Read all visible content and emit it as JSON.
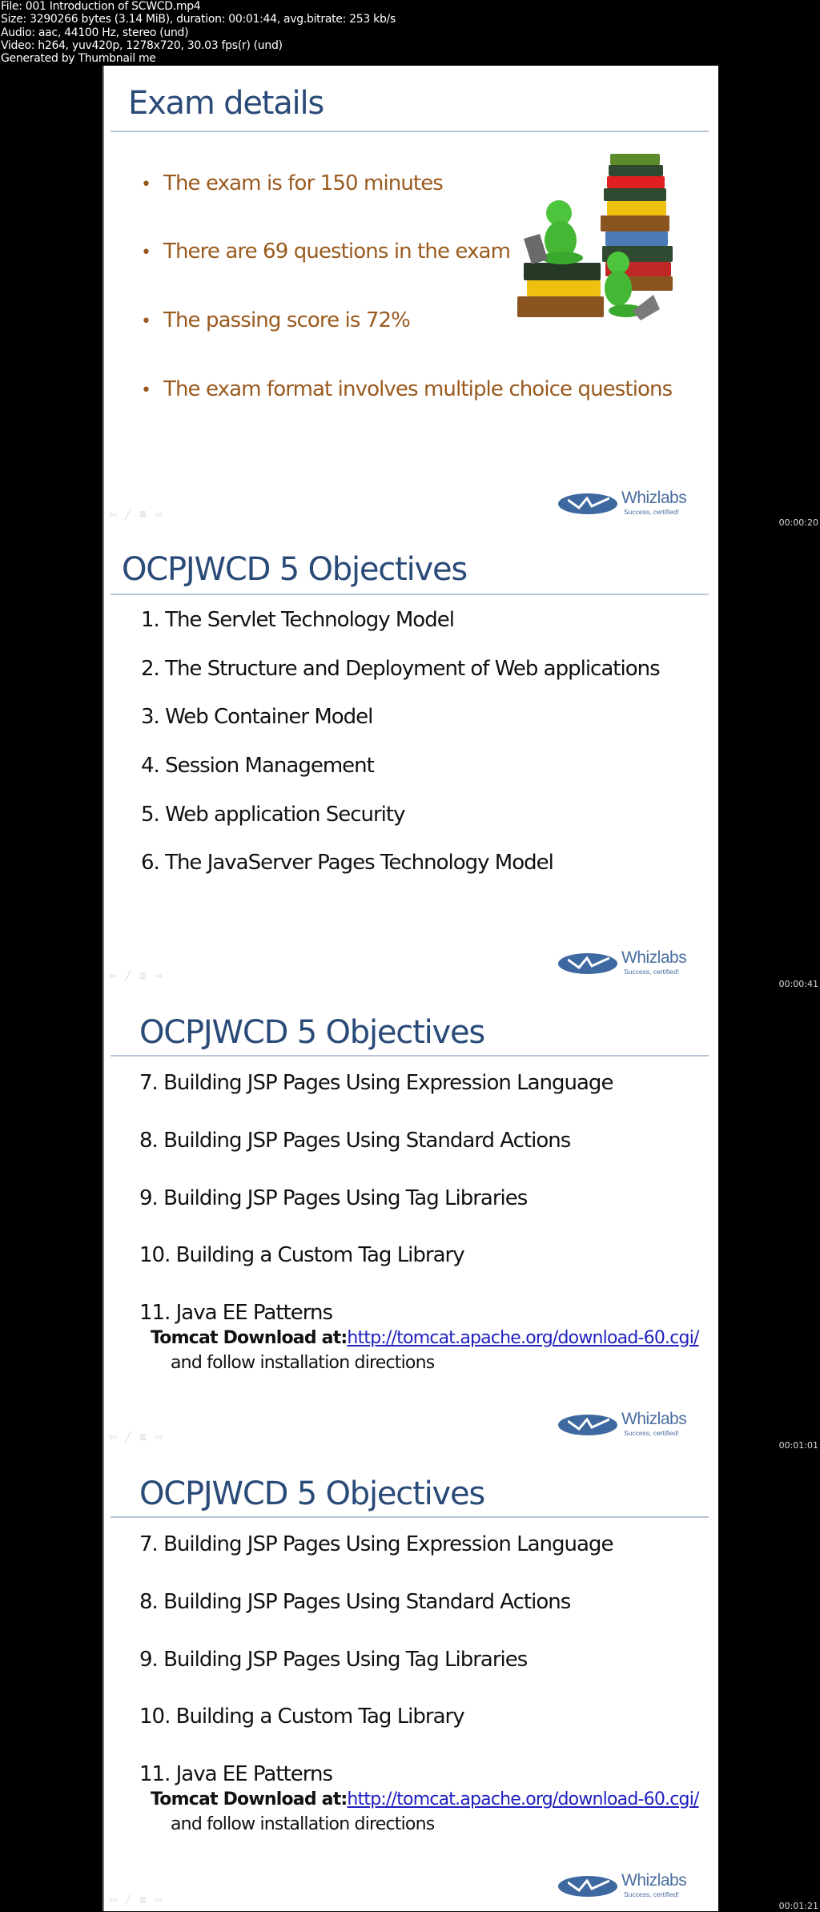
{
  "header": {
    "lines": [
      "File: 001 Introduction of SCWCD.mp4",
      "Size: 3290266 bytes (3.14 MiB), duration: 00:01:44, avg.bitrate: 253 kb/s",
      "Audio: aac, 44100 Hz, stereo (und)",
      "Video: h264, yuv420p, 1278x720, 30.03 fps(r) (und)",
      "Generated by Thumbnail me"
    ]
  },
  "colors": {
    "title": "#2a4a78",
    "bullet_text": "#9a5a1e",
    "body_text": "#111111",
    "link": "#2020c0",
    "logo_blue": "#3d68a0",
    "rule": "#b7c6d6"
  },
  "logo": {
    "brand": "Whizlabs",
    "tagline": "Success, certified!"
  },
  "nav_icons": [
    "back-arrow-icon",
    "pen-icon",
    "menu-icon",
    "forward-arrow-icon"
  ],
  "frames": [
    {
      "timestamp": "00:00:20",
      "title": "Exam details",
      "bullets": [
        "The exam is for 150 minutes",
        "There are 69 questions in the exam",
        "The passing score is 72%",
        "The exam format involves multiple choice questions"
      ],
      "image": "books-and-figures-illustration"
    },
    {
      "timestamp": "00:00:41",
      "title": "OCPJWCD 5 Objectives",
      "objectives": [
        "1. The Servlet Technology Model",
        "2. The Structure and Deployment of Web applications",
        "3. Web Container Model",
        "4. Session Management",
        "5. Web application Security",
        "6. The JavaServer Pages Technology Model"
      ]
    },
    {
      "timestamp": "00:01:01",
      "title": "OCPJWCD 5 Objectives",
      "objectives": [
        "7. Building JSP Pages Using Expression Language",
        "8. Building JSP Pages Using Standard Actions",
        "9. Building JSP Pages Using Tag Libraries",
        "10. Building a Custom Tag Library",
        "11. Java EE Patterns"
      ],
      "tomcat_label": "Tomcat Download at:",
      "tomcat_link": "http://tomcat.apache.org/download-60.cgi/",
      "follow_text": "and follow installation directions"
    },
    {
      "timestamp": "00:01:21",
      "title": "OCPJWCD 5 Objectives",
      "objectives": [
        "7. Building JSP Pages Using Expression Language",
        "8. Building JSP Pages Using Standard Actions",
        "9. Building JSP Pages Using Tag Libraries",
        "10. Building a Custom Tag Library",
        "11. Java EE Patterns"
      ],
      "tomcat_label": "Tomcat Download at:",
      "tomcat_link": "http://tomcat.apache.org/download-60.cgi/",
      "follow_text": "and follow installation directions"
    }
  ]
}
